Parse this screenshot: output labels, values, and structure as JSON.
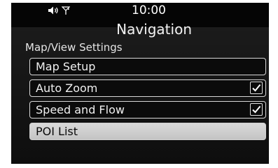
{
  "status": {
    "time": "10:00",
    "icons": [
      "volume-icon",
      "signal-icon"
    ]
  },
  "header": {
    "title": "Navigation"
  },
  "section": {
    "title": "Map/View Settings"
  },
  "menu": {
    "items": [
      {
        "label": "Map Setup",
        "has_checkbox": false
      },
      {
        "label": "Auto Zoom",
        "has_checkbox": true,
        "checked": true
      },
      {
        "label": "Speed and Flow",
        "has_checkbox": true,
        "checked": true
      },
      {
        "label": "POI List",
        "has_checkbox": false,
        "selected": true
      }
    ]
  }
}
